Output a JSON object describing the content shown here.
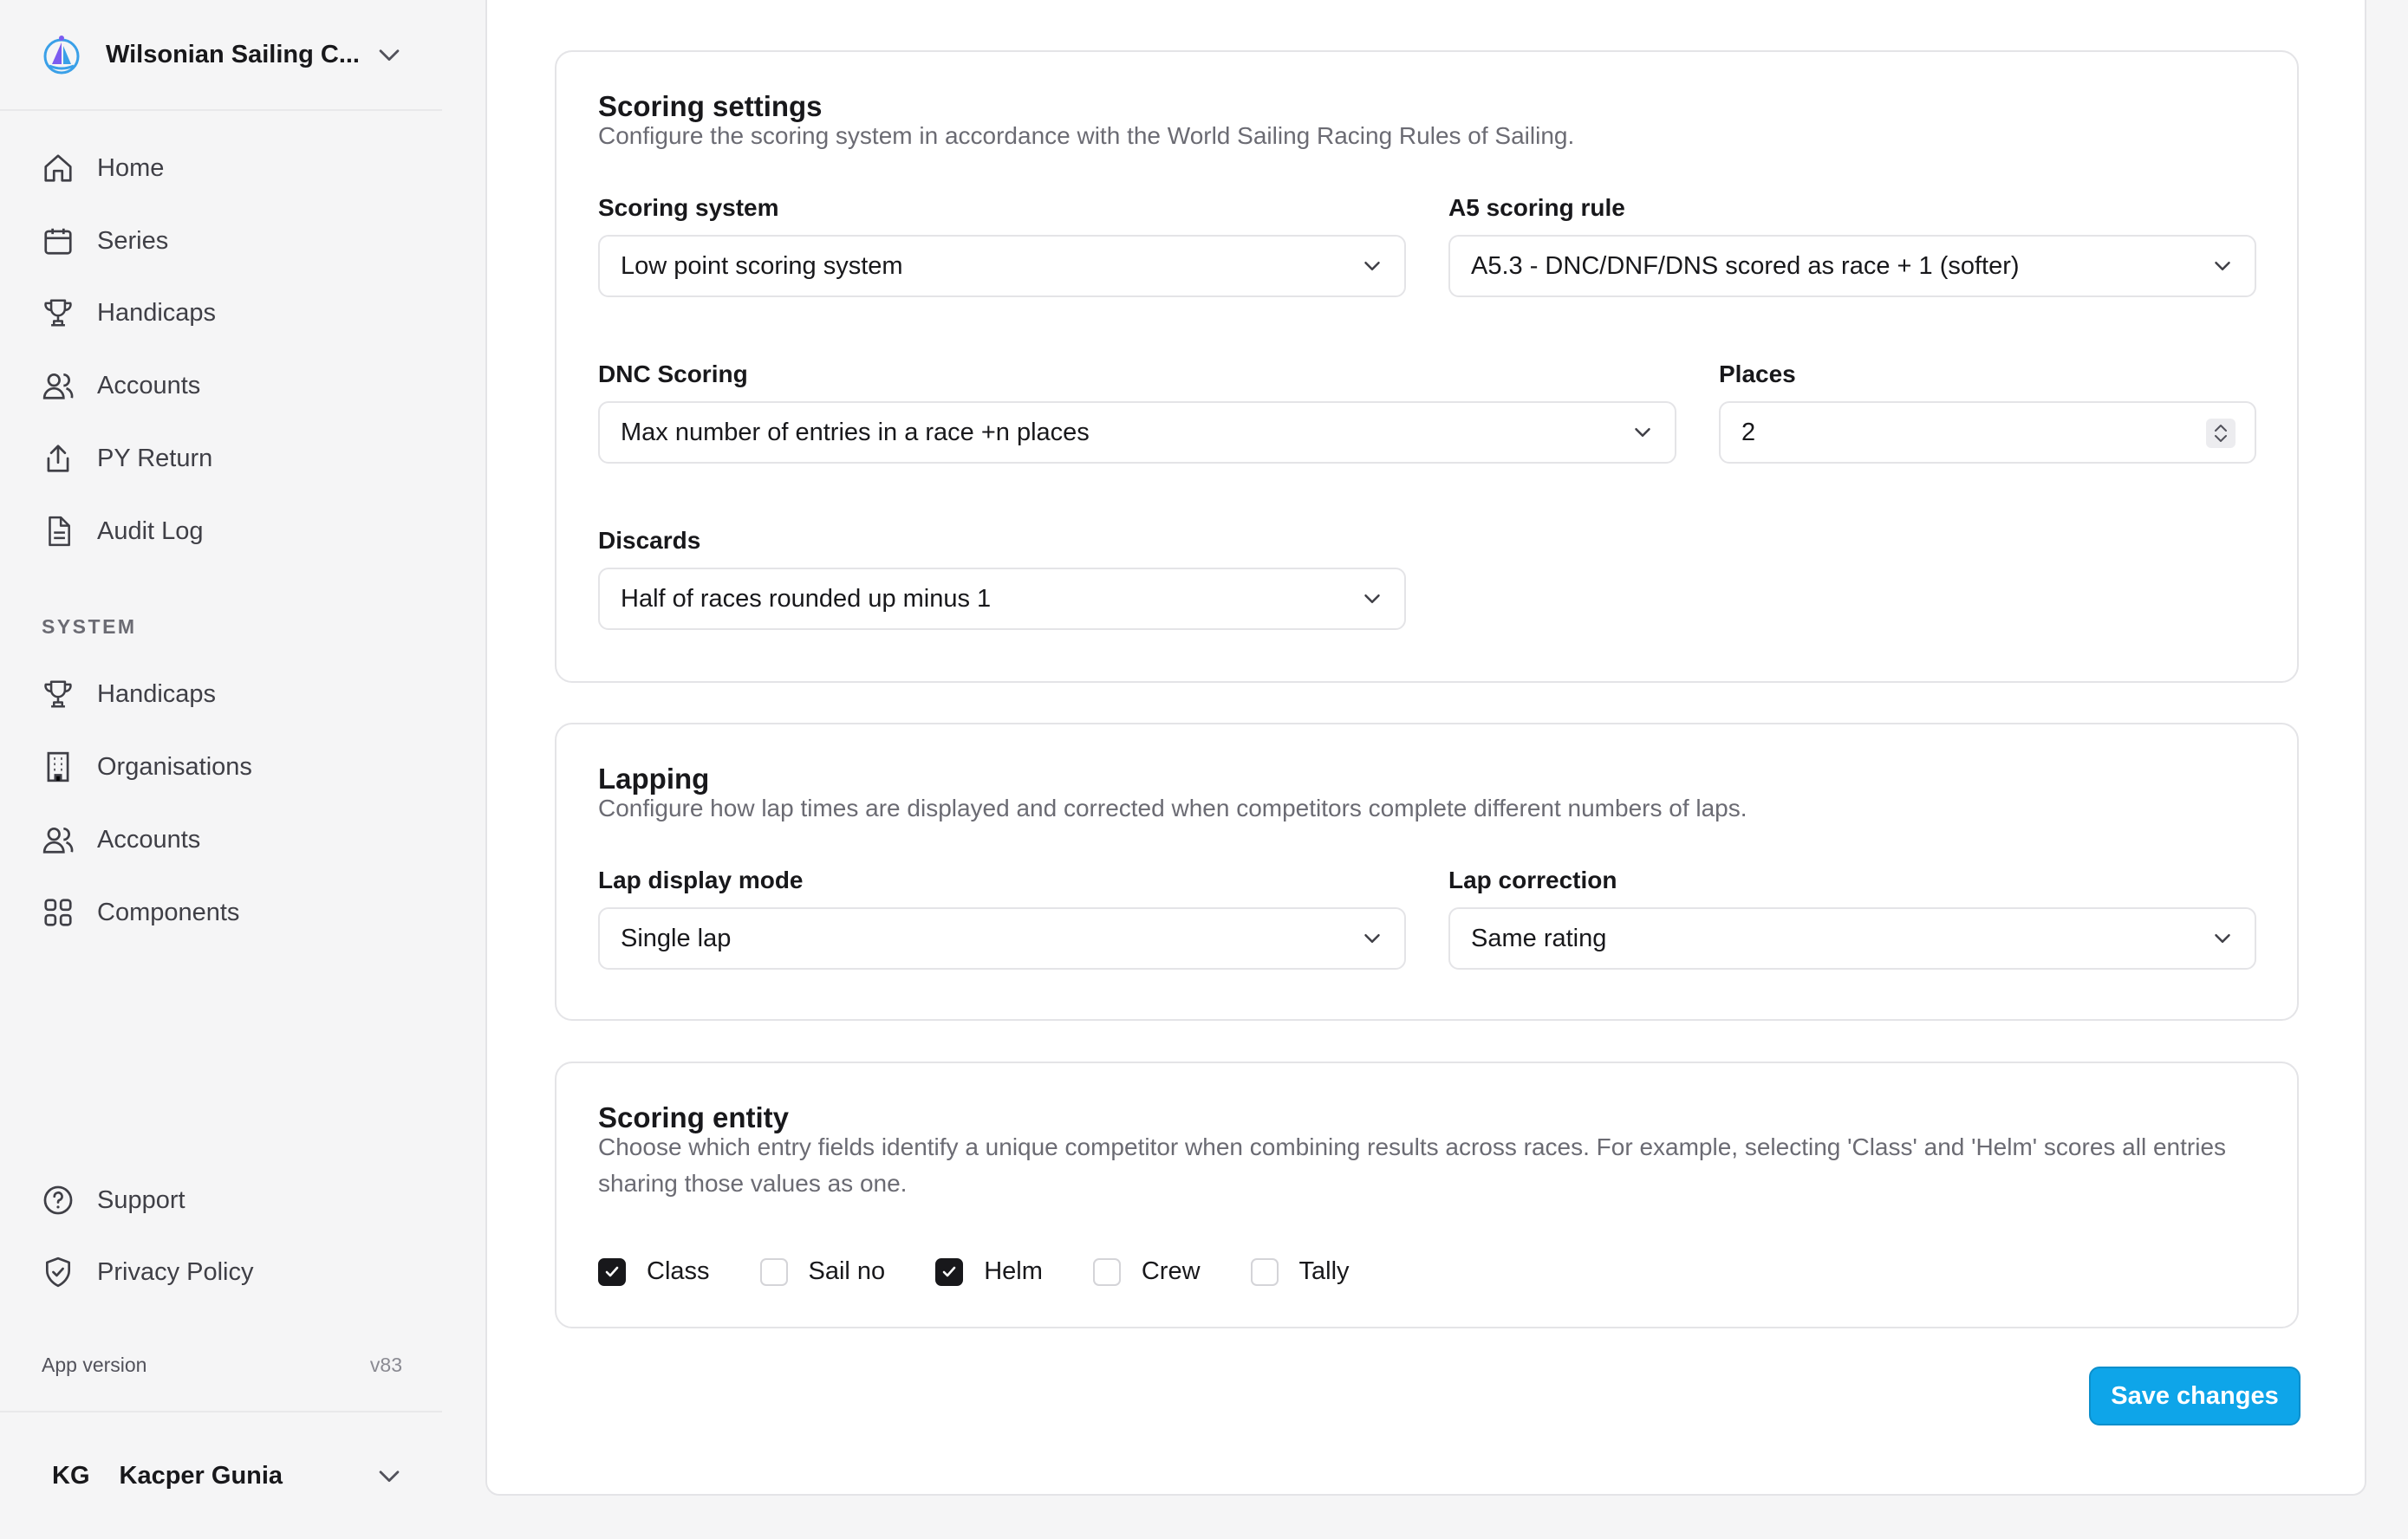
{
  "org": {
    "name": "Wilsonian Sailing C..."
  },
  "nav": {
    "main": [
      {
        "label": "Home",
        "icon": "home-icon"
      },
      {
        "label": "Series",
        "icon": "calendar-icon"
      },
      {
        "label": "Handicaps",
        "icon": "trophy-icon"
      },
      {
        "label": "Accounts",
        "icon": "users-icon"
      },
      {
        "label": "PY Return",
        "icon": "upload-icon"
      },
      {
        "label": "Audit Log",
        "icon": "file-icon"
      }
    ],
    "system_heading": "SYSTEM",
    "system": [
      {
        "label": "Handicaps",
        "icon": "trophy-icon"
      },
      {
        "label": "Organisations",
        "icon": "building-icon"
      },
      {
        "label": "Accounts",
        "icon": "users-icon"
      },
      {
        "label": "Components",
        "icon": "grid-icon"
      }
    ],
    "footer": [
      {
        "label": "Support",
        "icon": "help-circle-icon"
      },
      {
        "label": "Privacy Policy",
        "icon": "shield-icon"
      }
    ]
  },
  "app_version": {
    "label": "App version",
    "value": "v83"
  },
  "user": {
    "initials": "KG",
    "name": "Kacper Gunia"
  },
  "scoring": {
    "title": "Scoring settings",
    "description": "Configure the scoring system in accordance with the World Sailing Racing Rules of Sailing.",
    "system_label": "Scoring system",
    "system_value": "Low point scoring system",
    "a5_label": "A5 scoring rule",
    "a5_value": "A5.3 - DNC/DNF/DNS scored as race + 1 (softer)",
    "dnc_label": "DNC Scoring",
    "dnc_value": "Max number of entries in a race +n places",
    "places_label": "Places",
    "places_value": "2",
    "discards_label": "Discards",
    "discards_value": "Half of races rounded up minus 1"
  },
  "lapping": {
    "title": "Lapping",
    "description": "Configure how lap times are displayed and corrected when competitors complete different numbers of laps.",
    "display_label": "Lap display mode",
    "display_value": "Single lap",
    "correction_label": "Lap correction",
    "correction_value": "Same rating"
  },
  "entity": {
    "title": "Scoring entity",
    "description": "Choose which entry fields identify a unique competitor when combining results across races. For example, selecting 'Class' and 'Helm' scores all entries sharing those values as one.",
    "options": [
      {
        "label": "Class",
        "checked": true
      },
      {
        "label": "Sail no",
        "checked": false
      },
      {
        "label": "Helm",
        "checked": true
      },
      {
        "label": "Crew",
        "checked": false
      },
      {
        "label": "Tally",
        "checked": false
      }
    ]
  },
  "save_label": "Save changes",
  "colors": {
    "accent": "#0ea5e9",
    "text": "#18181b",
    "muted": "#6b6b73",
    "border": "#e4e4e7"
  }
}
